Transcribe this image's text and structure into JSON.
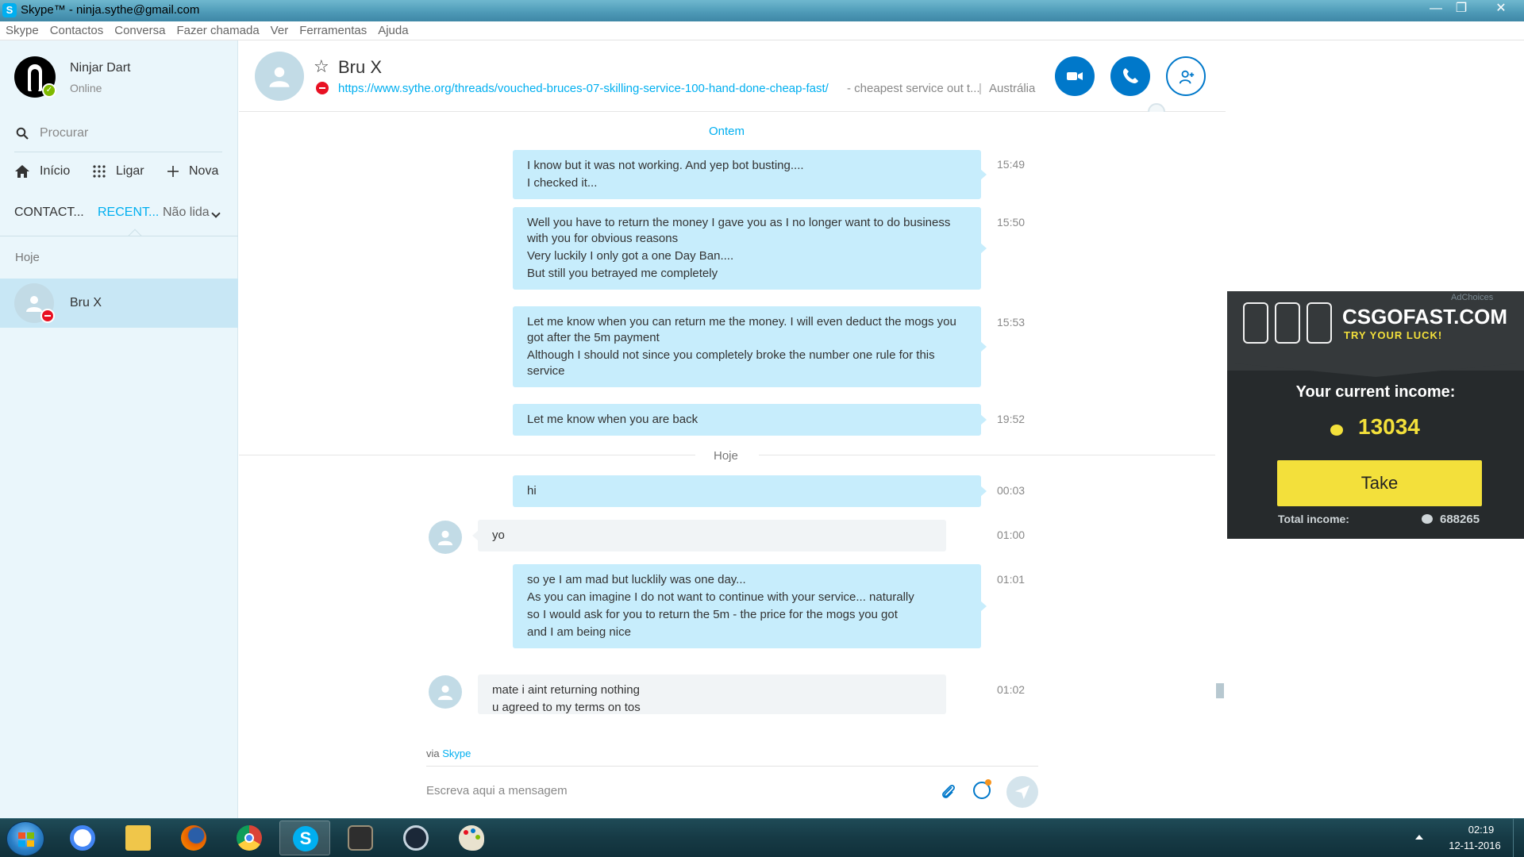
{
  "window": {
    "title": "Skype™ - ninja.sythe@gmail.com",
    "app_icon": "skype-icon",
    "controls": [
      "minimize-icon",
      "maximize-icon",
      "close-icon"
    ]
  },
  "menubar": [
    "Skype",
    "Contactos",
    "Conversa",
    "Fazer chamada",
    "Ver",
    "Ferramentas",
    "Ajuda"
  ],
  "sidebar": {
    "user": {
      "name": "Ninjar Dart",
      "status": "Online"
    },
    "search_label": "Procurar",
    "nav": [
      {
        "label": "Início",
        "icon": "home-icon"
      },
      {
        "label": "Ligar",
        "icon": "dialpad-icon"
      },
      {
        "label": "Nova",
        "icon": "plus-icon"
      }
    ],
    "tabs": {
      "contacts": "CONTACT...",
      "recent": "RECENT...",
      "unread": "Não lida"
    },
    "section": "Hoje",
    "contacts": [
      {
        "name": "Bru X",
        "presence": "busy"
      }
    ]
  },
  "chat": {
    "peer_name": "Bru X",
    "mood_link": "https://www.sythe.org/threads/vouched-bruces-07-skilling-service-100-hand-done-cheap-fast/",
    "mood_rest": "- cheapest service out t...",
    "separator": "|",
    "location": "Austrália",
    "day_yesterday": "Ontem",
    "day_today": "Hoje",
    "messages": [
      {
        "dir": "out",
        "lines": [
          "I know but it was not working. And yep bot busting....",
          "I checked it..."
        ],
        "time": "15:49"
      },
      {
        "dir": "out",
        "lines": [
          "Well you have to return the money I gave you as I no longer want to do business with you for obvious reasons",
          "Very luckily I only got a one Day Ban....",
          "But still you betrayed me completely"
        ],
        "time": "15:50"
      },
      {
        "dir": "out",
        "lines": [
          "Let me know when you can return me the money. I will even deduct the mogs you got after the 5m payment",
          "Although I should not since you completely broke the number one rule for this service"
        ],
        "time": "15:53"
      },
      {
        "dir": "out",
        "lines": [
          "Let me know when you are back"
        ],
        "time": "19:52"
      },
      {
        "dir": "out",
        "lines": [
          "hi"
        ],
        "time": "00:03"
      },
      {
        "dir": "in",
        "lines": [
          "yo"
        ],
        "time": "01:00"
      },
      {
        "dir": "out",
        "lines": [
          "so ye I am mad but lucklily was one day...",
          "As you can imagine I do not want to continue with your service... naturally",
          "so I would ask for you to return the 5m - the price for the mogs you got",
          "and I am being nice"
        ],
        "time": "01:01"
      },
      {
        "dir": "in",
        "lines": [
          "mate i aint returning nothing",
          "u agreed to my terms on tos"
        ],
        "time": "01:02"
      }
    ],
    "via_prefix": "via",
    "via_link": "Skype",
    "compose_placeholder": "Escreva aqui a mensagem"
  },
  "ad": {
    "choices": "AdChoices",
    "brand": "CSGOFAST.COM",
    "tagline": "TRY YOUR LUCK!",
    "income_label": "Your current income:",
    "income_value": "13034",
    "take_label": "Take",
    "total_label": "Total income:",
    "total_value": "688265"
  },
  "taskbar": {
    "apps": [
      "google-icon",
      "folder-icon",
      "firefox-icon",
      "chrome-icon",
      "skype-icon",
      "world-of-tanks-icon",
      "steam-icon",
      "paint-icon"
    ],
    "time": "02:19",
    "date": "12-11-2016"
  },
  "colors": {
    "skype_blue": "#00aff0",
    "accent_dark": "#0078ca",
    "bubble_out": "#c7edfc",
    "bubble_in": "#f1f4f6",
    "ad_yellow": "#f3e03b"
  }
}
